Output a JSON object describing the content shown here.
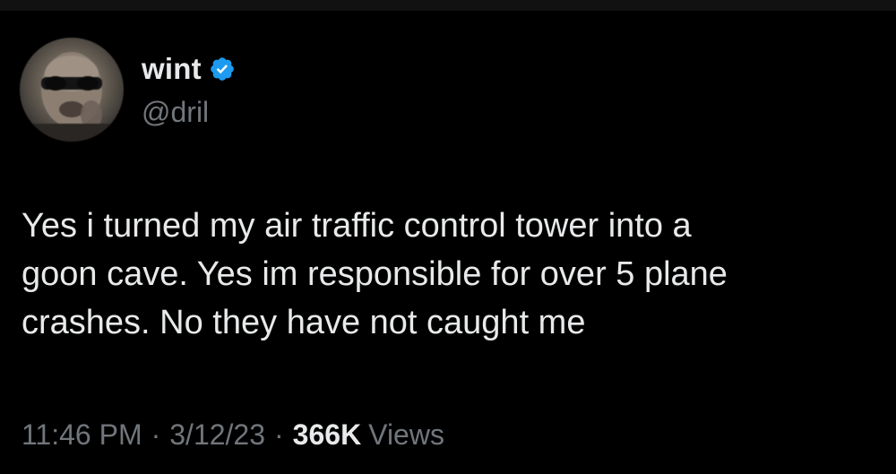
{
  "author": {
    "display_name": "wint",
    "handle": "@dril",
    "verified": true,
    "avatar_icon": "blurred-face-avatar"
  },
  "tweet": {
    "text": "Yes i turned my air traffic control tower into a\ngoon cave. Yes im responsible for over 5 plane\ncrashes. No they have not caught me"
  },
  "meta": {
    "time": "11:46 PM",
    "separator": "·",
    "date": "3/12/23",
    "views_count": "366K",
    "views_label": "Views"
  },
  "colors": {
    "background": "#000000",
    "primary_text": "#e7e9ea",
    "secondary_text": "#71767b",
    "verified_blue": "#1d9bf0"
  }
}
